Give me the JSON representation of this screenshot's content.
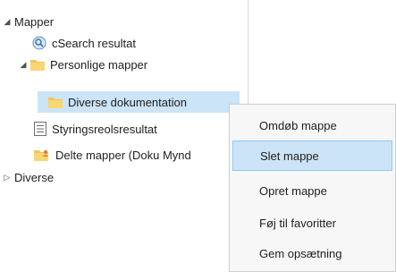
{
  "tree": {
    "root_mapper": {
      "label": "Mapper",
      "arrow": "◢"
    },
    "csearch": {
      "label": "cSearch resultat",
      "icon": "search-icon"
    },
    "personlige": {
      "label": "Personlige mapper",
      "arrow": "◢",
      "icon": "folder-icon"
    },
    "diverse_dok": {
      "label": "Diverse dokumentation",
      "icon": "folder-icon"
    },
    "styring": {
      "label": "Styringsreolsresultat",
      "icon": "list-icon"
    },
    "delte": {
      "label": "Delte mapper (Doku Mynd",
      "icon": "shared-folder-icon"
    },
    "root_diverse": {
      "label": "Diverse",
      "arrow": "▷"
    }
  },
  "context_menu": {
    "items": [
      {
        "label": "Omdøb mappe"
      },
      {
        "label": "Slet mappe"
      },
      {
        "label": "Opret mappe"
      },
      {
        "label": "Føj til favoritter"
      },
      {
        "label": "Gem opsætning"
      }
    ]
  },
  "colors": {
    "selection": "#cce4f7",
    "folder": "#f2c45c",
    "menu_background": "#f7f7f7"
  }
}
